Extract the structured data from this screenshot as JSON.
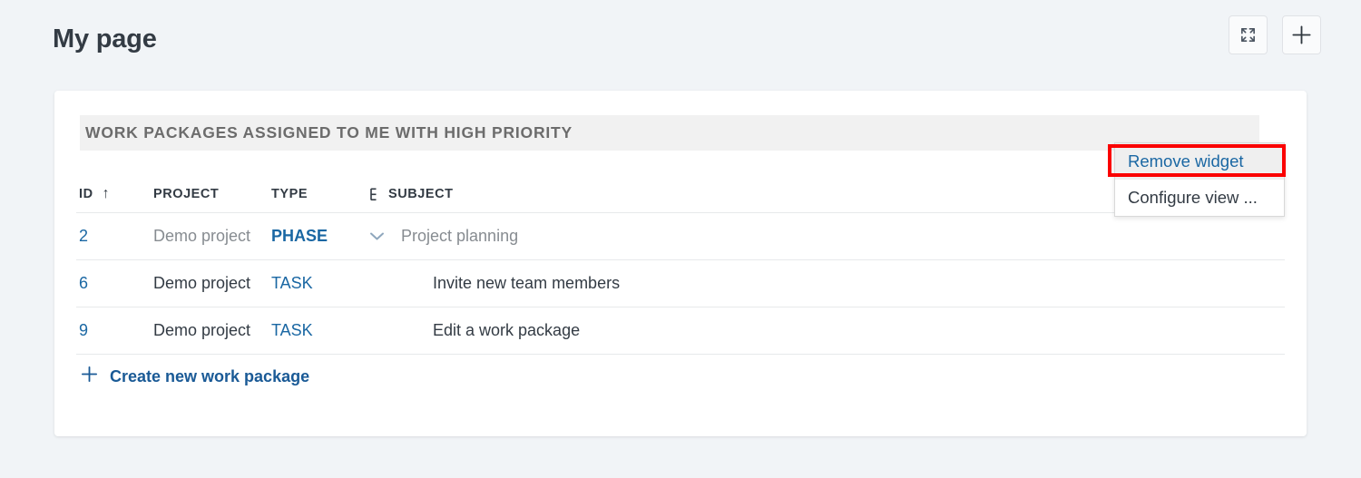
{
  "page": {
    "title": "My page"
  },
  "header_actions": [
    {
      "name": "fullscreen-button",
      "icon": "fullscreen-icon",
      "label": ""
    },
    {
      "name": "add-widget-button",
      "icon": "plus-icon",
      "label": ""
    }
  ],
  "widget": {
    "title": "WORK PACKAGES ASSIGNED TO ME WITH HIGH PRIORITY",
    "table": {
      "columns": [
        {
          "key": "id",
          "label": "ID",
          "sort": "asc",
          "sort_icon": "arrow-up-icon"
        },
        {
          "key": "project",
          "label": "PROJECT"
        },
        {
          "key": "type",
          "label": "TYPE"
        },
        {
          "key": "subject",
          "label": "SUBJECT",
          "icon": "hierarchy-icon"
        }
      ],
      "rows": [
        {
          "id": "2",
          "project": "Demo project",
          "type": "PHASE",
          "type_bold": true,
          "subject": "Project planning",
          "expander": "chevron-down-icon",
          "muted": true
        },
        {
          "id": "6",
          "project": "Demo project",
          "type": "TASK",
          "type_bold": false,
          "subject": "Invite new team members",
          "expander": "",
          "muted": false
        },
        {
          "id": "9",
          "project": "Demo project",
          "type": "TASK",
          "type_bold": false,
          "subject": "Edit a work package",
          "expander": "",
          "muted": false
        }
      ]
    },
    "create_link": {
      "label": "Create new work package",
      "icon": "plus-icon"
    }
  },
  "dropdown": {
    "items": [
      {
        "label": "Remove widget",
        "active": true
      },
      {
        "label": "Configure view ...",
        "active": false
      }
    ]
  },
  "colors": {
    "page_background": "#f1f4f7",
    "card_background": "#ffffff",
    "widget_title_bar": "#f1f1f1",
    "link_blue": "#1a67a3",
    "text_dark": "#333b44",
    "text_muted": "#878c91",
    "annotation_red": "#fb0000",
    "menu_hover": "#efefef"
  }
}
